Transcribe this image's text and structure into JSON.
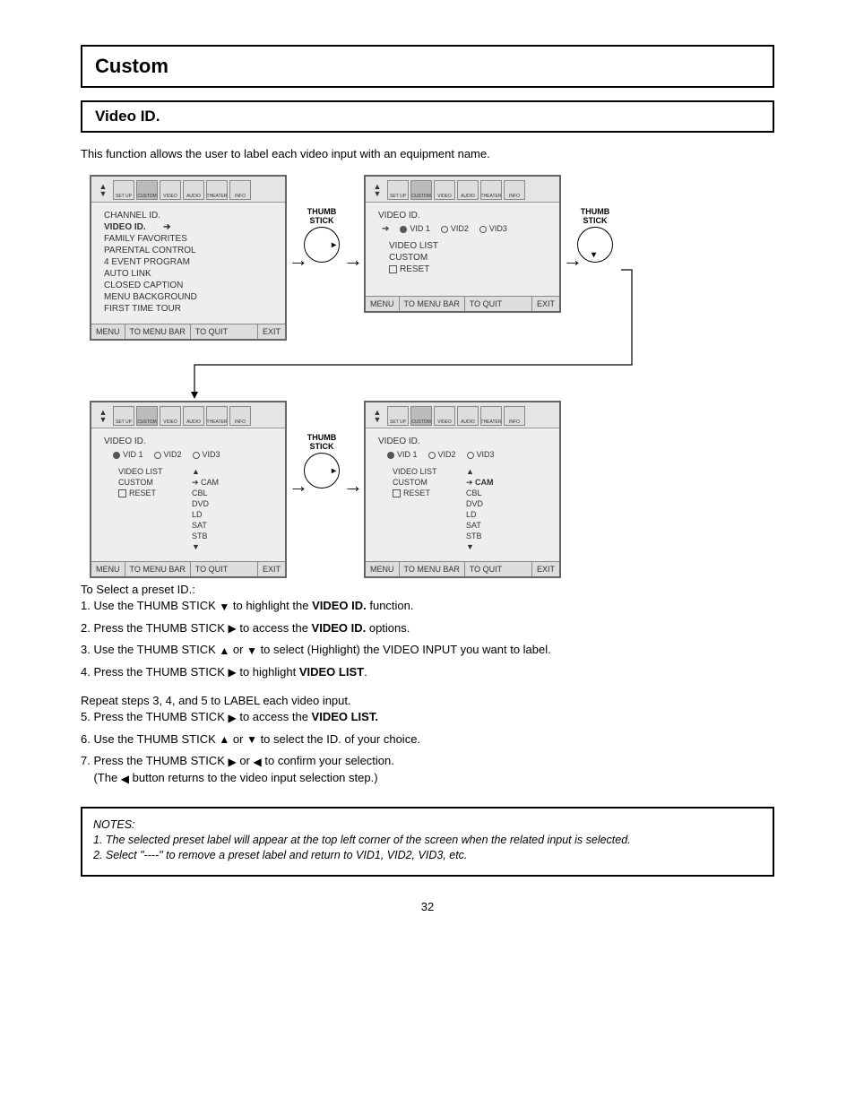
{
  "title": "Custom",
  "subtitle": "Video ID.",
  "intro": "This function allows the user to label each video input with an equipment name.",
  "iconbar": [
    "",
    "SET UP",
    "CUSTOM",
    "VIDEO",
    "AUDIO",
    "THEATER",
    "INFO"
  ],
  "screen1": {
    "items": [
      "CHANNEL ID.",
      "VIDEO ID.",
      "FAMILY FAVORITES",
      "PARENTAL CONTROL",
      "4 EVENT PROGRAM",
      "AUTO LINK",
      "CLOSED CAPTION",
      "MENU BACKGROUND",
      "FIRST TIME TOUR"
    ]
  },
  "screen2": {
    "header": "VIDEO ID.",
    "radios": [
      "VID 1",
      "VID2",
      "VID3"
    ],
    "lines": [
      "VIDEO LIST",
      "CUSTOM"
    ],
    "reset": "RESET"
  },
  "screen3": {
    "header": "VIDEO ID.",
    "radios": [
      "VID 1",
      "VID2",
      "VID3"
    ],
    "left": [
      "VIDEO  LIST",
      "CUSTOM"
    ],
    "right": [
      "CAM",
      "CBL",
      "DVD",
      "LD",
      "SAT",
      "STB"
    ],
    "reset": "RESET"
  },
  "screen4": {
    "header": "VIDEO ID.",
    "radios": [
      "VID 1",
      "VID2",
      "VID3"
    ],
    "left": [
      "VIDEO  LIST",
      "CUSTOM"
    ],
    "right": [
      "CAM",
      "CBL",
      "DVD",
      "LD",
      "SAT",
      "STB"
    ],
    "reset": "RESET"
  },
  "footer": {
    "a": "MENU",
    "b": "TO MENU BAR",
    "c": "TO QUIT",
    "d": "EXIT"
  },
  "thumb": "THUMB\nSTICK",
  "setA": {
    "head": "To Select a preset ID.:",
    "s1a": "Use the THUMB STICK ",
    "s1b": " to highlight the ",
    "s1c": "VIDEO ID.",
    "s1d": " function.",
    "s2a": "Press the THUMB STICK ",
    "s2b": " to access the ",
    "s2c": "VIDEO ID.",
    "s2d": " options.",
    "s3a": "Use the THUMB STICK ",
    "s3b": " or ",
    "s3c": " to select (Highlight) the VIDEO INPUT you want to label.",
    "s4a": "Press the THUMB STICK ",
    "s4b": " to highlight ",
    "s4c": "VIDEO LIST",
    "s4d": "."
  },
  "setB": {
    "head": "Repeat steps 3, 4, and 5 to LABEL each video input.",
    "s5a": "Press the THUMB STICK ",
    "s5b": " to access the ",
    "s5c": "VIDEO LIST.",
    "s6a": "Use the THUMB STICK ",
    "s6b": " or ",
    "s6c": " to select the ID. of your choice.",
    "s7a": "Press the THUMB STICK ",
    "s7b": " or ",
    "s7c": " to confirm your selection.",
    "s7d": "(The ",
    "s7e": " button returns to the video input selection step.)"
  },
  "note": {
    "h": "NOTES:",
    "l1": "1. The selected preset label will appear at the top left corner of the screen when the related input is selected.",
    "l2": "2. Select \"----\" to remove a preset label and return to VID1, VID2, VID3, etc."
  },
  "page": "32"
}
